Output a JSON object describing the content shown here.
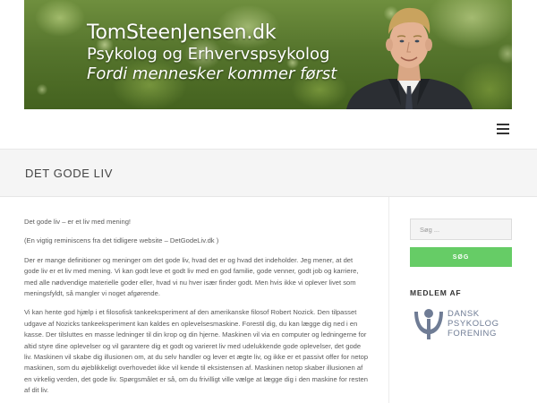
{
  "header": {
    "site_name": "TomSteenJensen.dk",
    "role": "Psykolog og Erhvervspsykolog",
    "tagline": "Fordi mennesker kommer først"
  },
  "nav": {
    "menu_icon": "hamburger-menu-icon"
  },
  "page": {
    "title": "DET GODE LIV"
  },
  "content": {
    "paragraphs": [
      "Det gode liv – er et liv med mening!",
      "(En vigtig reminiscens fra det tidligere website – DetGodeLiv.dk )",
      "Der er mange definitioner og meninger om det gode liv, hvad det er og hvad det indeholder. Jeg mener, at det gode liv er et liv med mening. Vi kan godt leve et godt liv med en god familie, gode venner, godt job og karriere, med alle nødvendige materielle goder eller, hvad vi nu hver især finder godt. Men hvis ikke vi oplever livet som meningsfyldt, så mangler vi noget afgørende.",
      "Vi kan hente god hjælp i et filosofisk tankeeksperiment af den amerikanske filosof Robert Nozick. Den tilpasset udgave af Nozicks tankeeksperiment kan kaldes en oplevelsesmaskine. Forestil dig, du kan lægge dig ned i en kasse. Der tilsluttes en masse ledninger til din krop og din hjerne. Maskinen vil via en computer og ledningerne for altid styre dine oplevelser og vil garantere dig et godt og varieret liv med udelukkende gode oplevelser, det gode liv. Maskinen vil skabe dig illusionen om, at du selv handler og lever et ægte liv, og ikke er et passivt offer for netop maskinen, som du øjeblikkeligt overhovedet ikke vil kende til eksistensen af. Maskinen netop skaber illusionen af en virkelig verden, det gode liv. Spørgsmålet er så, om du frivilligt ville vælge at lægge dig i den maskine for resten af dit liv."
    ]
  },
  "sidebar": {
    "search_placeholder": "Søg ...",
    "search_button": "SØG",
    "member_heading": "MEDLEM AF",
    "logo": {
      "icon": "dansk-psykolog-forening-logo",
      "line1": "DANSK",
      "line2": "PSYKOLOG",
      "line3": "FORENING"
    }
  },
  "colors": {
    "accent_green": "#66cc66",
    "title_band": "#f5f5f5",
    "logo_blue": "#6f7c95"
  }
}
